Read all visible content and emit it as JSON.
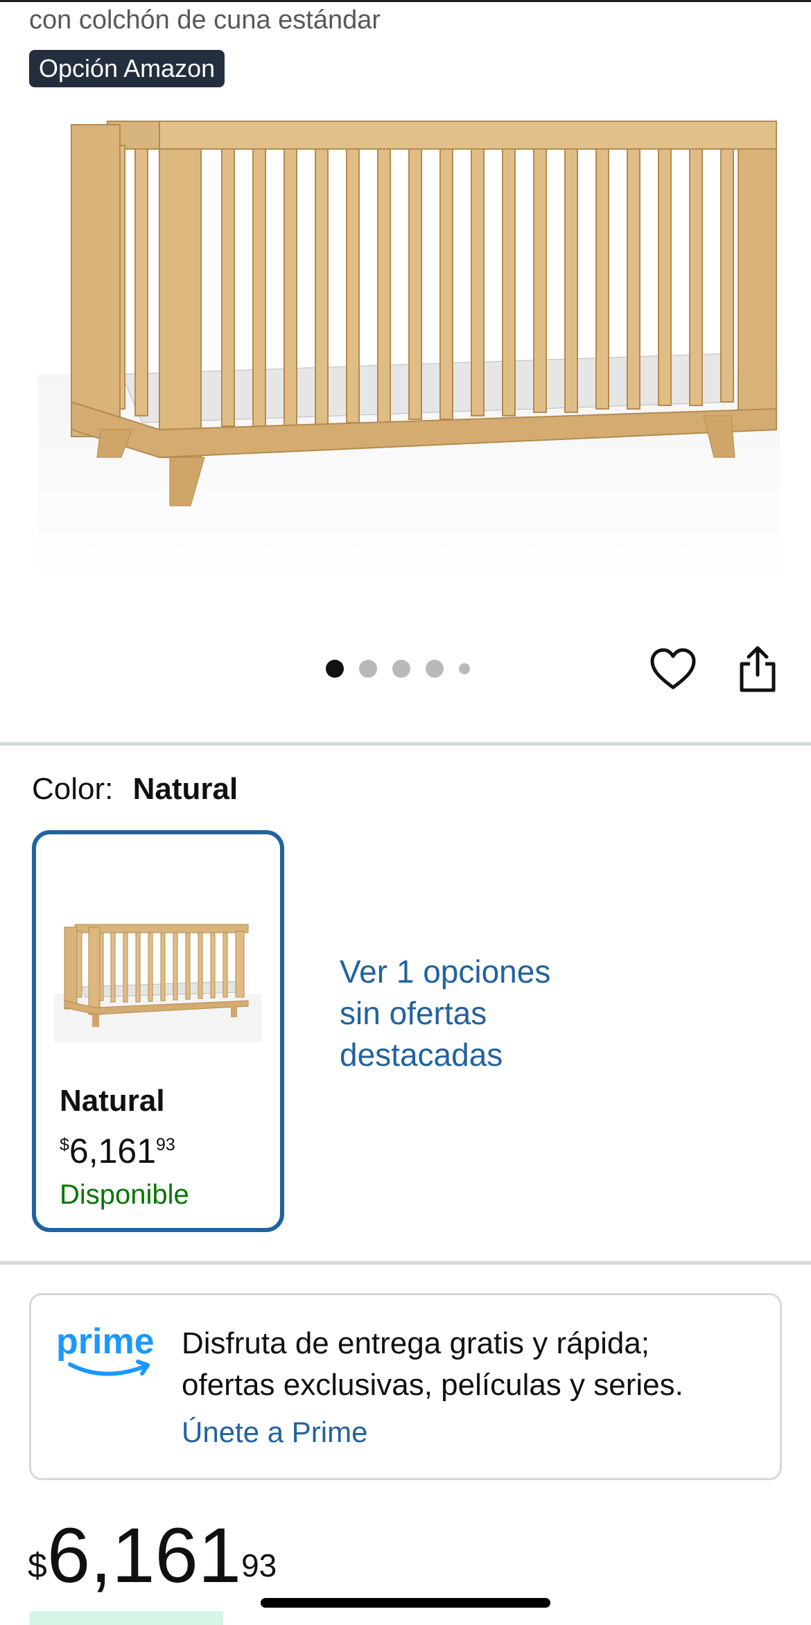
{
  "product": {
    "subtitle": "con colchón de cuna estándar",
    "badge": "Opción Amazon"
  },
  "gallery": {
    "dots": [
      {
        "active": true
      },
      {
        "active": false
      },
      {
        "active": false
      },
      {
        "active": false
      },
      {
        "active": false,
        "small": true
      }
    ]
  },
  "color": {
    "label": "Color:",
    "selected": "Natural"
  },
  "swatch": {
    "name": "Natural",
    "currency": "$",
    "price_whole": "6,161",
    "price_cents": "93",
    "availability": "Disponible"
  },
  "more_options": "Ver 1 opciones sin ofertas destacadas",
  "prime": {
    "logo_text": "prime",
    "text": "Disfruta de entrega gratis y rápida; ofertas exclusivas, películas y series.",
    "link": "Únete a Prime"
  },
  "price": {
    "currency": "$",
    "whole": "6,161",
    "cents": "93"
  },
  "colors": {
    "link": "#2162a1",
    "available": "#007600",
    "badge_bg": "#232f3e"
  },
  "icons": [
    "heart-icon",
    "share-icon"
  ]
}
